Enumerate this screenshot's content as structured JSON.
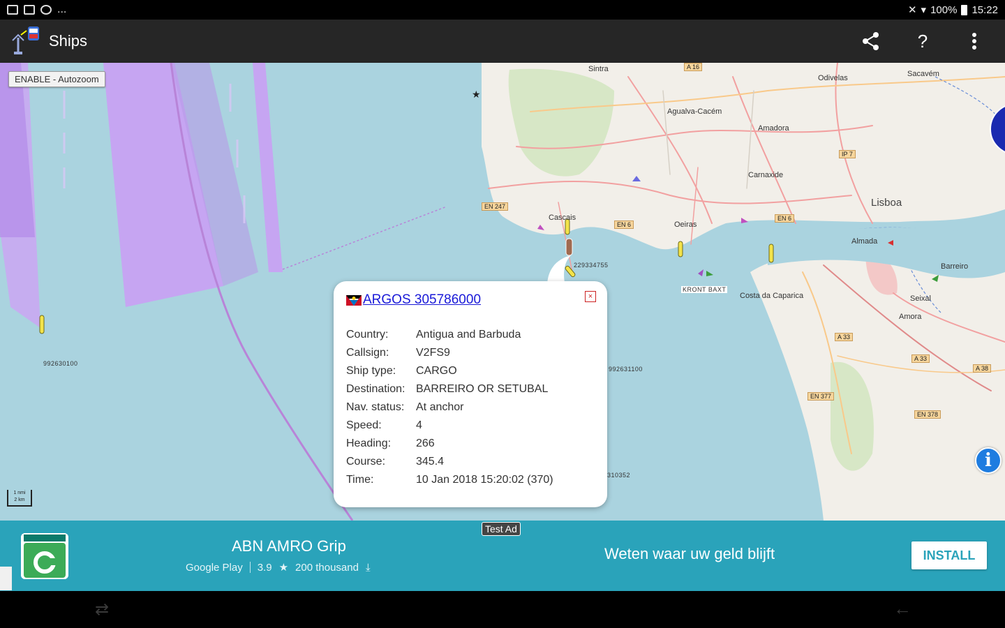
{
  "status_bar": {
    "battery": "100%",
    "time": "15:22",
    "overflow": "..."
  },
  "app_bar": {
    "title": "Ships",
    "icons": [
      "share-icon",
      "help-icon",
      "overflow-menu-icon"
    ],
    "help_label": "?"
  },
  "map": {
    "autozoom_label": "ENABLE - Autozoom",
    "scale_top": "1 nmi",
    "scale_bottom": "2 km",
    "city_big": "Lisboa",
    "cities": [
      "Sintra",
      "Cascais",
      "Oeiras",
      "Almada",
      "Barreiro",
      "Carnaxide",
      "Amadora",
      "Odivelas",
      "Sacavém",
      "Seixal",
      "Amora",
      "Costa da Caparica",
      "Agualva-Cacém"
    ],
    "roads": [
      "EN 247",
      "EN 6",
      "IP 7",
      "EN 6",
      "A 33",
      "A 38",
      "EN 377",
      "EN 378",
      "A 33",
      "A 16"
    ],
    "ship_ids": [
      "992630100",
      "229334755",
      "992631100",
      "310352"
    ],
    "ship_label_main": "KRONT BAXT"
  },
  "popup": {
    "title": "ARGOS 305786000",
    "close_label": "×",
    "fields": [
      {
        "key": "Country:",
        "value": "Antigua and Barbuda"
      },
      {
        "key": "Callsign:",
        "value": "V2FS9"
      },
      {
        "key": "Ship type:",
        "value": "CARGO"
      },
      {
        "key": "Destination:",
        "value": "BARREIRO OR SETUBAL"
      },
      {
        "key": "Nav. status:",
        "value": "At anchor"
      },
      {
        "key": "Speed:",
        "value": "4"
      },
      {
        "key": "Heading:",
        "value": "266"
      },
      {
        "key": "Course:",
        "value": "345.4"
      },
      {
        "key": "Time:",
        "value": "10 Jan 2018 15:20:02 (370)"
      }
    ]
  },
  "ad": {
    "test_label": "Test Ad",
    "app_name": "ABN AMRO Grip",
    "store": "Google Play",
    "rating": "3.9",
    "downloads": "200 thousand",
    "slogan": "Weten waar uw geld blijft",
    "install_label": "INSTALL"
  },
  "colors": {
    "water": "#aad3df",
    "land": "#f2efe9",
    "ad_bg": "#2aa3ba",
    "appbar": "#262626",
    "link": "#1a1ad8",
    "purple_zone": "#c9a8f2"
  }
}
